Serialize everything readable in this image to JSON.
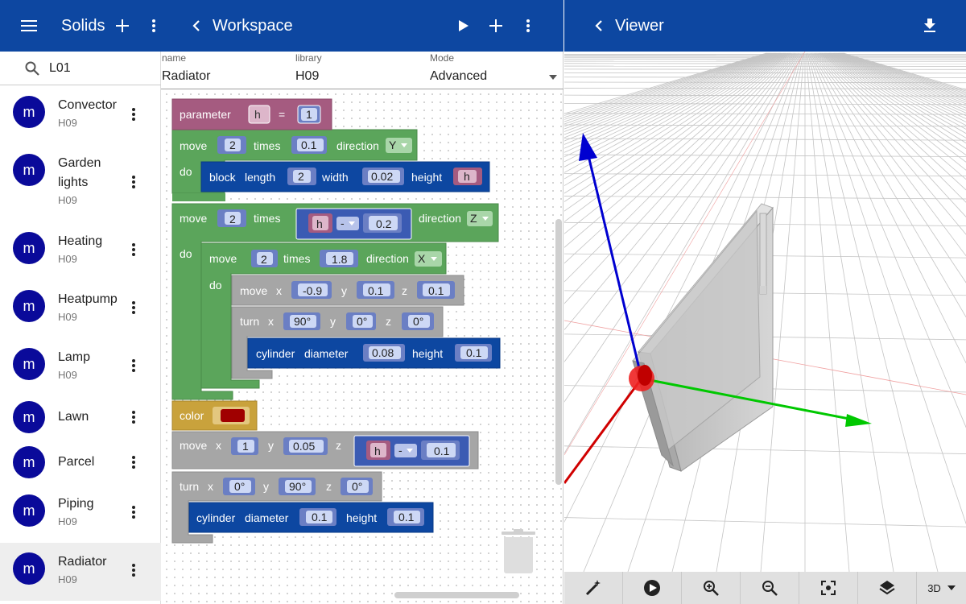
{
  "sidebar": {
    "title": "Solids",
    "search_value": "L01",
    "items": [
      {
        "avatar": "m",
        "name": "Convector",
        "library": "H09"
      },
      {
        "avatar": "m",
        "name": "Garden lights",
        "library": "H09"
      },
      {
        "avatar": "m",
        "name": "Heating",
        "library": "H09"
      },
      {
        "avatar": "m",
        "name": "Heatpump",
        "library": "H09"
      },
      {
        "avatar": "m",
        "name": "Lamp",
        "library": "H09"
      },
      {
        "avatar": "m",
        "name": "Lawn",
        "library": ""
      },
      {
        "avatar": "m",
        "name": "Parcel",
        "library": ""
      },
      {
        "avatar": "m",
        "name": "Piping",
        "library": "H09"
      },
      {
        "avatar": "m",
        "name": "Radiator",
        "library": "H09"
      }
    ],
    "selected_index": 8
  },
  "workspace": {
    "title": "Workspace",
    "fields": {
      "name_label": "name",
      "name_value": "Radiator",
      "library_label": "library",
      "library_value": "H09",
      "mode_label": "Mode",
      "mode_value": "Advanced"
    },
    "blocks": {
      "parameter": "parameter",
      "param_var": "h",
      "equals": "=",
      "param_value": "1",
      "move": "move",
      "times": "times",
      "direction": "direction",
      "do": "do",
      "m1_count": "2",
      "m1_step": "0.1",
      "m1_dir": "Y",
      "block": "block",
      "length": "length",
      "width": "width",
      "height": "height",
      "block_length": "2",
      "block_width": "0.02",
      "block_height": "h",
      "m2_count": "2",
      "m2_var": "h",
      "minus": "-",
      "m2_sub": "0.2",
      "m2_dir": "Z",
      "m3_count": "2",
      "m3_step": "1.8",
      "m3_dir": "X",
      "x": "x",
      "y": "y",
      "z": "z",
      "mv1_x": "-0.9",
      "mv1_y": "0.1",
      "mv1_z": "0.1",
      "turn": "turn",
      "t1_x": "90°",
      "t1_y": "0°",
      "t1_z": "0°",
      "cylinder": "cylinder",
      "diameter": "diameter",
      "c1_diameter": "0.08",
      "c1_height": "0.1",
      "color": "color",
      "color_value": "#a00000",
      "mv2_x": "1",
      "mv2_y": "0.05",
      "mv2_z_var": "h",
      "mv2_z_sub": "0.1",
      "t2_x": "0°",
      "t2_y": "90°",
      "t2_z": "0°",
      "c2_diameter": "0.1",
      "c2_height": "0.1"
    }
  },
  "viewer": {
    "title": "Viewer",
    "view_mode": "3D",
    "axis_colors": {
      "x": "#00c800",
      "y": "#0000d0",
      "z": "#d00000"
    }
  },
  "colors": {
    "appbar": "#0d47a1",
    "avatar": "#0a0a9a",
    "block_parameter": "#a55b80",
    "block_loop": "#5ba55b",
    "block_solid": "#0d47a1",
    "block_transform": "#a6a6a6",
    "block_color": "#c9a23c"
  }
}
